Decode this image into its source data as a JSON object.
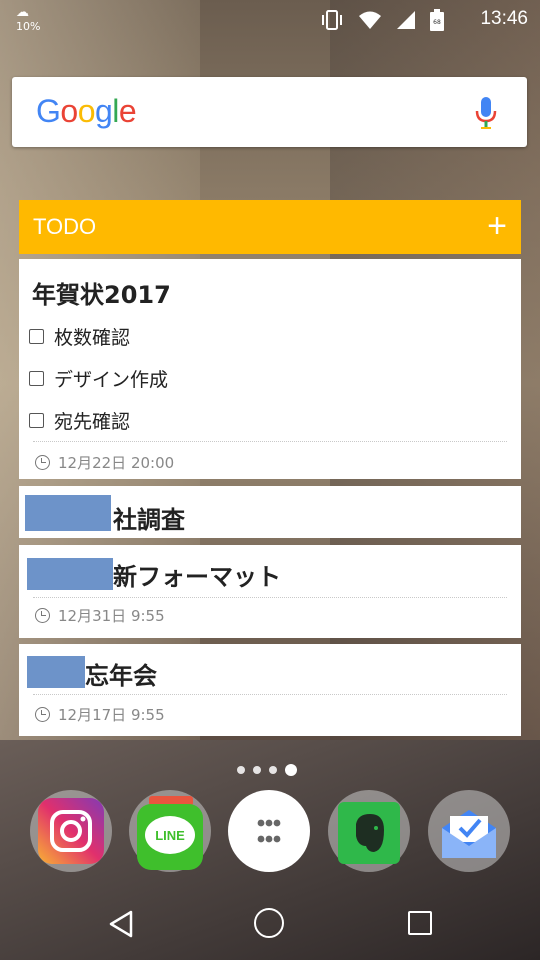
{
  "statusbar": {
    "weather_temp": "10%",
    "clock": "13:46",
    "battery_level": "68"
  },
  "search": {
    "logo": "Google"
  },
  "todo": {
    "title": "TODO",
    "add_label": "+",
    "items": [
      {
        "title": "年賀状2017",
        "subtasks": [
          "枚数確認",
          "デザイン作成",
          "宛先確認"
        ],
        "due": "12月22日 20:00"
      },
      {
        "title": "社調査"
      },
      {
        "title": "新フォーマット",
        "due": "12月31日 9:55"
      },
      {
        "title": "忘年会",
        "due": "12月17日 9:55"
      }
    ]
  },
  "dock": {
    "line_label": "LINE"
  },
  "colors": {
    "todo_accent": "#ffb900",
    "redaction": "#6d93c9"
  }
}
